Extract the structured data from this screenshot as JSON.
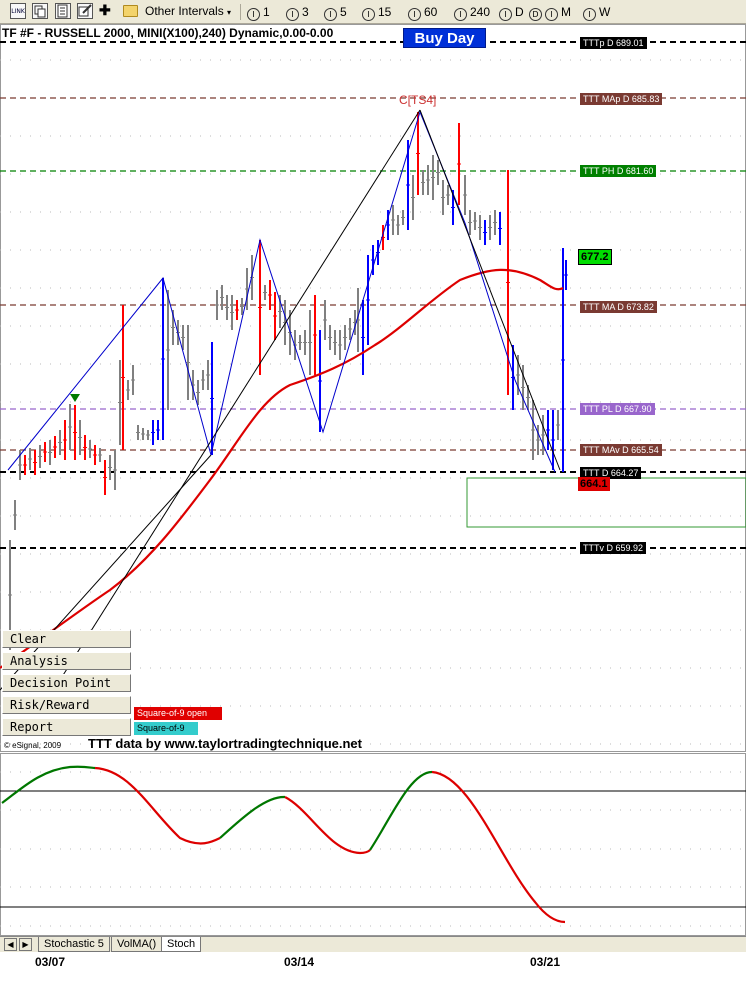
{
  "toolbar": {
    "icons": [
      "link-icon",
      "copy-icon",
      "properties-icon",
      "add-icon",
      "folder-icon"
    ],
    "link_text": "LINK",
    "plus_glyph": "✚",
    "interval_menu": "Other Intervals",
    "interval_glyph": "I",
    "daily_glyph": "D",
    "intervals": [
      "1",
      "3",
      "5",
      "15",
      "60",
      "240",
      "D",
      "M",
      "W"
    ]
  },
  "chart": {
    "title": "TF #F - RUSSELL 2000, MINI(X100),240) Dynamic,0.00-0.00",
    "buy_day": "Buy Day",
    "ts_label": "C[TS4]",
    "last_price_top": "677.2",
    "last_price_bottom": "664.1",
    "colors": {
      "up_bar": "#0000ff",
      "down_bar": "#ff0000",
      "neutral_bar": "#808080",
      "moving_average": "#dd0000",
      "buy_day": "#0030d8"
    },
    "levels": [
      {
        "label": "TTTp D 689.01",
        "bg": "#000000",
        "line": "#000000"
      },
      {
        "label": "TTT MAp D 685.83",
        "bg": "#7a3a32",
        "line": "#7a3a32"
      },
      {
        "label": "TTT PH D 681.60",
        "bg": "#008000",
        "line": "#008000"
      },
      {
        "label": "TTT MA D 673.82",
        "bg": "#7a3a32",
        "line": "#7a3a32"
      },
      {
        "label": "TTT PL D 667.90",
        "bg": "#9966cc",
        "line": "#9966cc"
      },
      {
        "label": "TTT MAv D 665.54",
        "bg": "#7a3a32",
        "line": "#7a3a32"
      },
      {
        "label": "TTT D 664.27",
        "bg": "#000000",
        "line": "#000000"
      },
      {
        "label": "TTTv D 659.92",
        "bg": "#000000",
        "line": "#000000"
      }
    ]
  },
  "buttons": [
    "Clear",
    "Analysis",
    "Decision Point",
    "Risk/Reward",
    "Report"
  ],
  "square_labels": [
    {
      "label": "Square-of-9 open",
      "bg": "#e00000",
      "fg": "#ffffff"
    },
    {
      "label": "Square-of-9",
      "bg": "#33cccc",
      "fg": "#000000"
    }
  ],
  "footer": {
    "copyright": "© eSignal, 2009",
    "credit": "TTT data by www.taylortradingtechnique.net"
  },
  "oscillator": {
    "rising_color": "#007700",
    "falling_color": "#dd0000"
  },
  "tabs": {
    "prev_glyph": "◀",
    "next_glyph": "▶",
    "items": [
      "Stochastic 5",
      "VolMA()",
      "Stoch"
    ],
    "active": "Stoch"
  },
  "x_axis": [
    "03/07",
    "03/14",
    "03/21"
  ]
}
